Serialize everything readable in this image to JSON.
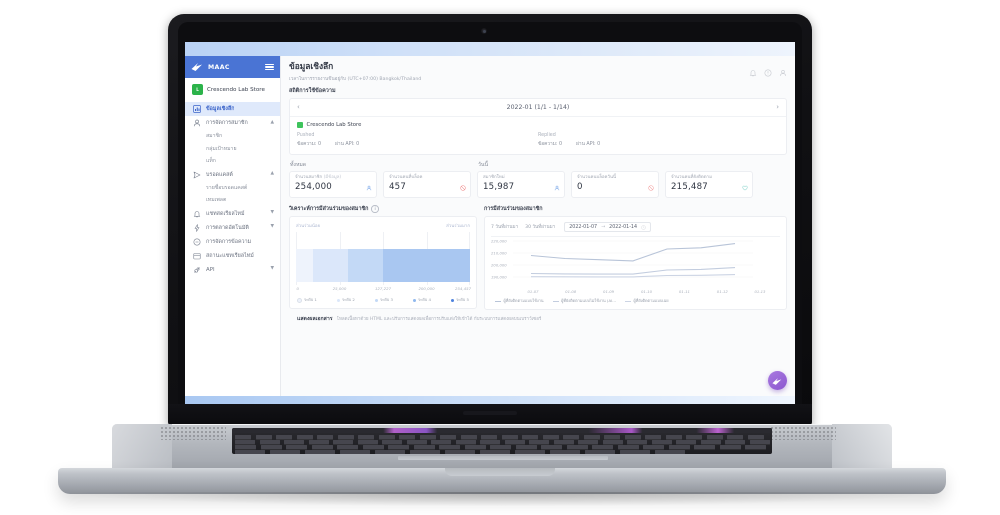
{
  "brand": {
    "name": "MAAC",
    "logo_icon": "maac-logo-icon",
    "menu_icon": "hamburger-menu-icon"
  },
  "store": {
    "name": "Crescendo Lab Store",
    "badge": "L"
  },
  "sidebar": {
    "items": [
      {
        "label": "ข้อมูลเชิงลึก",
        "icon": "chart-bar-icon",
        "active": true,
        "caret": ""
      },
      {
        "label": "การจัดการสมาชิก",
        "icon": "user-icon",
        "active": false,
        "caret": "▲"
      },
      {
        "label": "บรอดแคสต์",
        "icon": "send-icon",
        "active": false,
        "caret": "▲"
      },
      {
        "label": "แชทสดเรียลไทม์",
        "icon": "bell-icon",
        "active": false,
        "caret": "▼"
      },
      {
        "label": "การตลาดอัตโนมัติ",
        "icon": "lightning-icon",
        "active": false,
        "caret": "▼"
      },
      {
        "label": "การจัดการข้อความ",
        "icon": "chat-icon",
        "active": false,
        "caret": ""
      },
      {
        "label": "สถานะแชทเรียลไทม์",
        "icon": "calendar-icon",
        "active": false,
        "caret": ""
      },
      {
        "label": "API",
        "icon": "plug-icon",
        "active": false,
        "caret": "▼"
      }
    ],
    "sub_members": [
      "สมาชิก",
      "กลุ่มเป้าหมาย",
      "แท็ก"
    ],
    "sub_broadcast": [
      "รายชื่อบรอดแคสต์",
      "เทมเพลต"
    ]
  },
  "topbar": {
    "title": "ข้อมูลเชิงลึก",
    "icons": [
      "bell-icon",
      "help-icon",
      "account-icon"
    ]
  },
  "page": {
    "timezone_note": "เวลาในการรายงานขึ้นอยู่กับ (UTC+07:00) Bangkok/Thailand",
    "section_label": "สถิติการใช้ข้อความ"
  },
  "date_card": {
    "prev_icon": "chevron-left-icon",
    "next_icon": "chevron-right-icon",
    "range": "2022-01 (1/1 - 1/14)",
    "store_name": "Crescendo Lab Store",
    "columns": [
      {
        "title": "Pushed",
        "metrics": [
          "ข้อความ: 0",
          "ผ่าน API: 0"
        ]
      },
      {
        "title": "Replied",
        "metrics": [
          "ข้อความ: 0",
          "ผ่าน API: 0"
        ]
      }
    ]
  },
  "stats": {
    "total_label": "ทั้งหมด",
    "today_label": "วันนี้",
    "total_cards": [
      {
        "label": "จำนวนสมาชิก",
        "label_muted": "(มีข้อมูล)",
        "value": "254,000",
        "icon": "user-icon",
        "icon_color": "#7aa7e8"
      },
      {
        "label": "จำนวนคนที่บล็อค",
        "value": "457",
        "icon": "block-icon",
        "icon_color": "#f08a8a"
      }
    ],
    "today_cards": [
      {
        "label": "สมาชิกใหม่",
        "value": "15,987",
        "icon": "user-icon",
        "icon_color": "#7aa7e8"
      },
      {
        "label": "จำนวนคนบล็อควันนี้",
        "value": "0",
        "icon": "block-icon",
        "icon_color": "#f3a0a0"
      },
      {
        "label": "จำนวนคนที่ยังติดตาม",
        "value": "215,487",
        "icon": "heart-icon",
        "icon_color": "#8ad4cc"
      }
    ]
  },
  "chart_data": [
    {
      "type": "bar",
      "title": "วิเคราะห์การมีส่วนร่วมของสมาชิก",
      "info_icon": "info-icon",
      "left_end_label": "ส่วนร่วมน้อย",
      "right_end_label": "ส่วนร่วมมาก",
      "categories": [
        "ระดับ 1",
        "ระดับ 2",
        "ระดับ 3",
        "ระดับ 4",
        "ระดับ 5"
      ],
      "values": [
        25000,
        51113,
        51113,
        51113,
        76118
      ],
      "colors": [
        "#eef3fc",
        "#dbe7fa",
        "#c3d9f6",
        "#a9c7f1",
        "#a9c7f1"
      ],
      "xlabel": "",
      "ylabel": "",
      "xticks": [
        "0",
        "25,000",
        "127,227",
        "200,000",
        "254,457"
      ],
      "xlim": [
        0,
        254457
      ],
      "grid": true,
      "legend_position": "bottom"
    },
    {
      "type": "line",
      "title": "การมีส่วนร่วมของสมาชิก",
      "tabs": [
        "7 วันที่ผ่านมา",
        "30 วันที่ผ่านมา"
      ],
      "date_from": "2022-01-07",
      "date_to": "2022-01-14",
      "date_separator": "→",
      "calendar_icon": "calendar-icon",
      "x": [
        "01-07",
        "01-08",
        "01-09",
        "01-10",
        "01-11",
        "01-12",
        "01-13"
      ],
      "yticks": [
        "220,000",
        "210,000",
        "200,000",
        "190,000"
      ],
      "ylim": [
        185000,
        225000
      ],
      "grid": true,
      "legend_position": "bottom",
      "series": [
        {
          "name": "ผู้ที่ยังติดตามแบบใช้งาน",
          "color": "#b8c4d8",
          "values": [
            206500,
            204000,
            203000,
            202000,
            212000,
            213000,
            216500
          ]
        },
        {
          "name": "ผู้ที่ยังติดตามแบบไม่ใช้งาน (AI...",
          "color": "#c3cddf",
          "values": [
            191500,
            191200,
            191000,
            191000,
            194500,
            195000,
            196500
          ]
        },
        {
          "name": "ผู้ที่ยังติดตามแบบเฉย",
          "color": "#ccd4e4",
          "values": [
            188800,
            188700,
            188600,
            188600,
            189800,
            190000,
            190600
          ]
        }
      ]
    }
  ],
  "footer": {
    "strong": "แสดงผลเอกสาร",
    "text": "โหลดเนื้อหาด้วย HTML และปรับการแสดงผลเพื่อการปรับแต่งให้เข้าได้ กับระบบการแสดงผลบนเบราว์เซอร์"
  },
  "fab": {
    "icon": "maac-logo-icon",
    "color": "#8b56cf"
  }
}
